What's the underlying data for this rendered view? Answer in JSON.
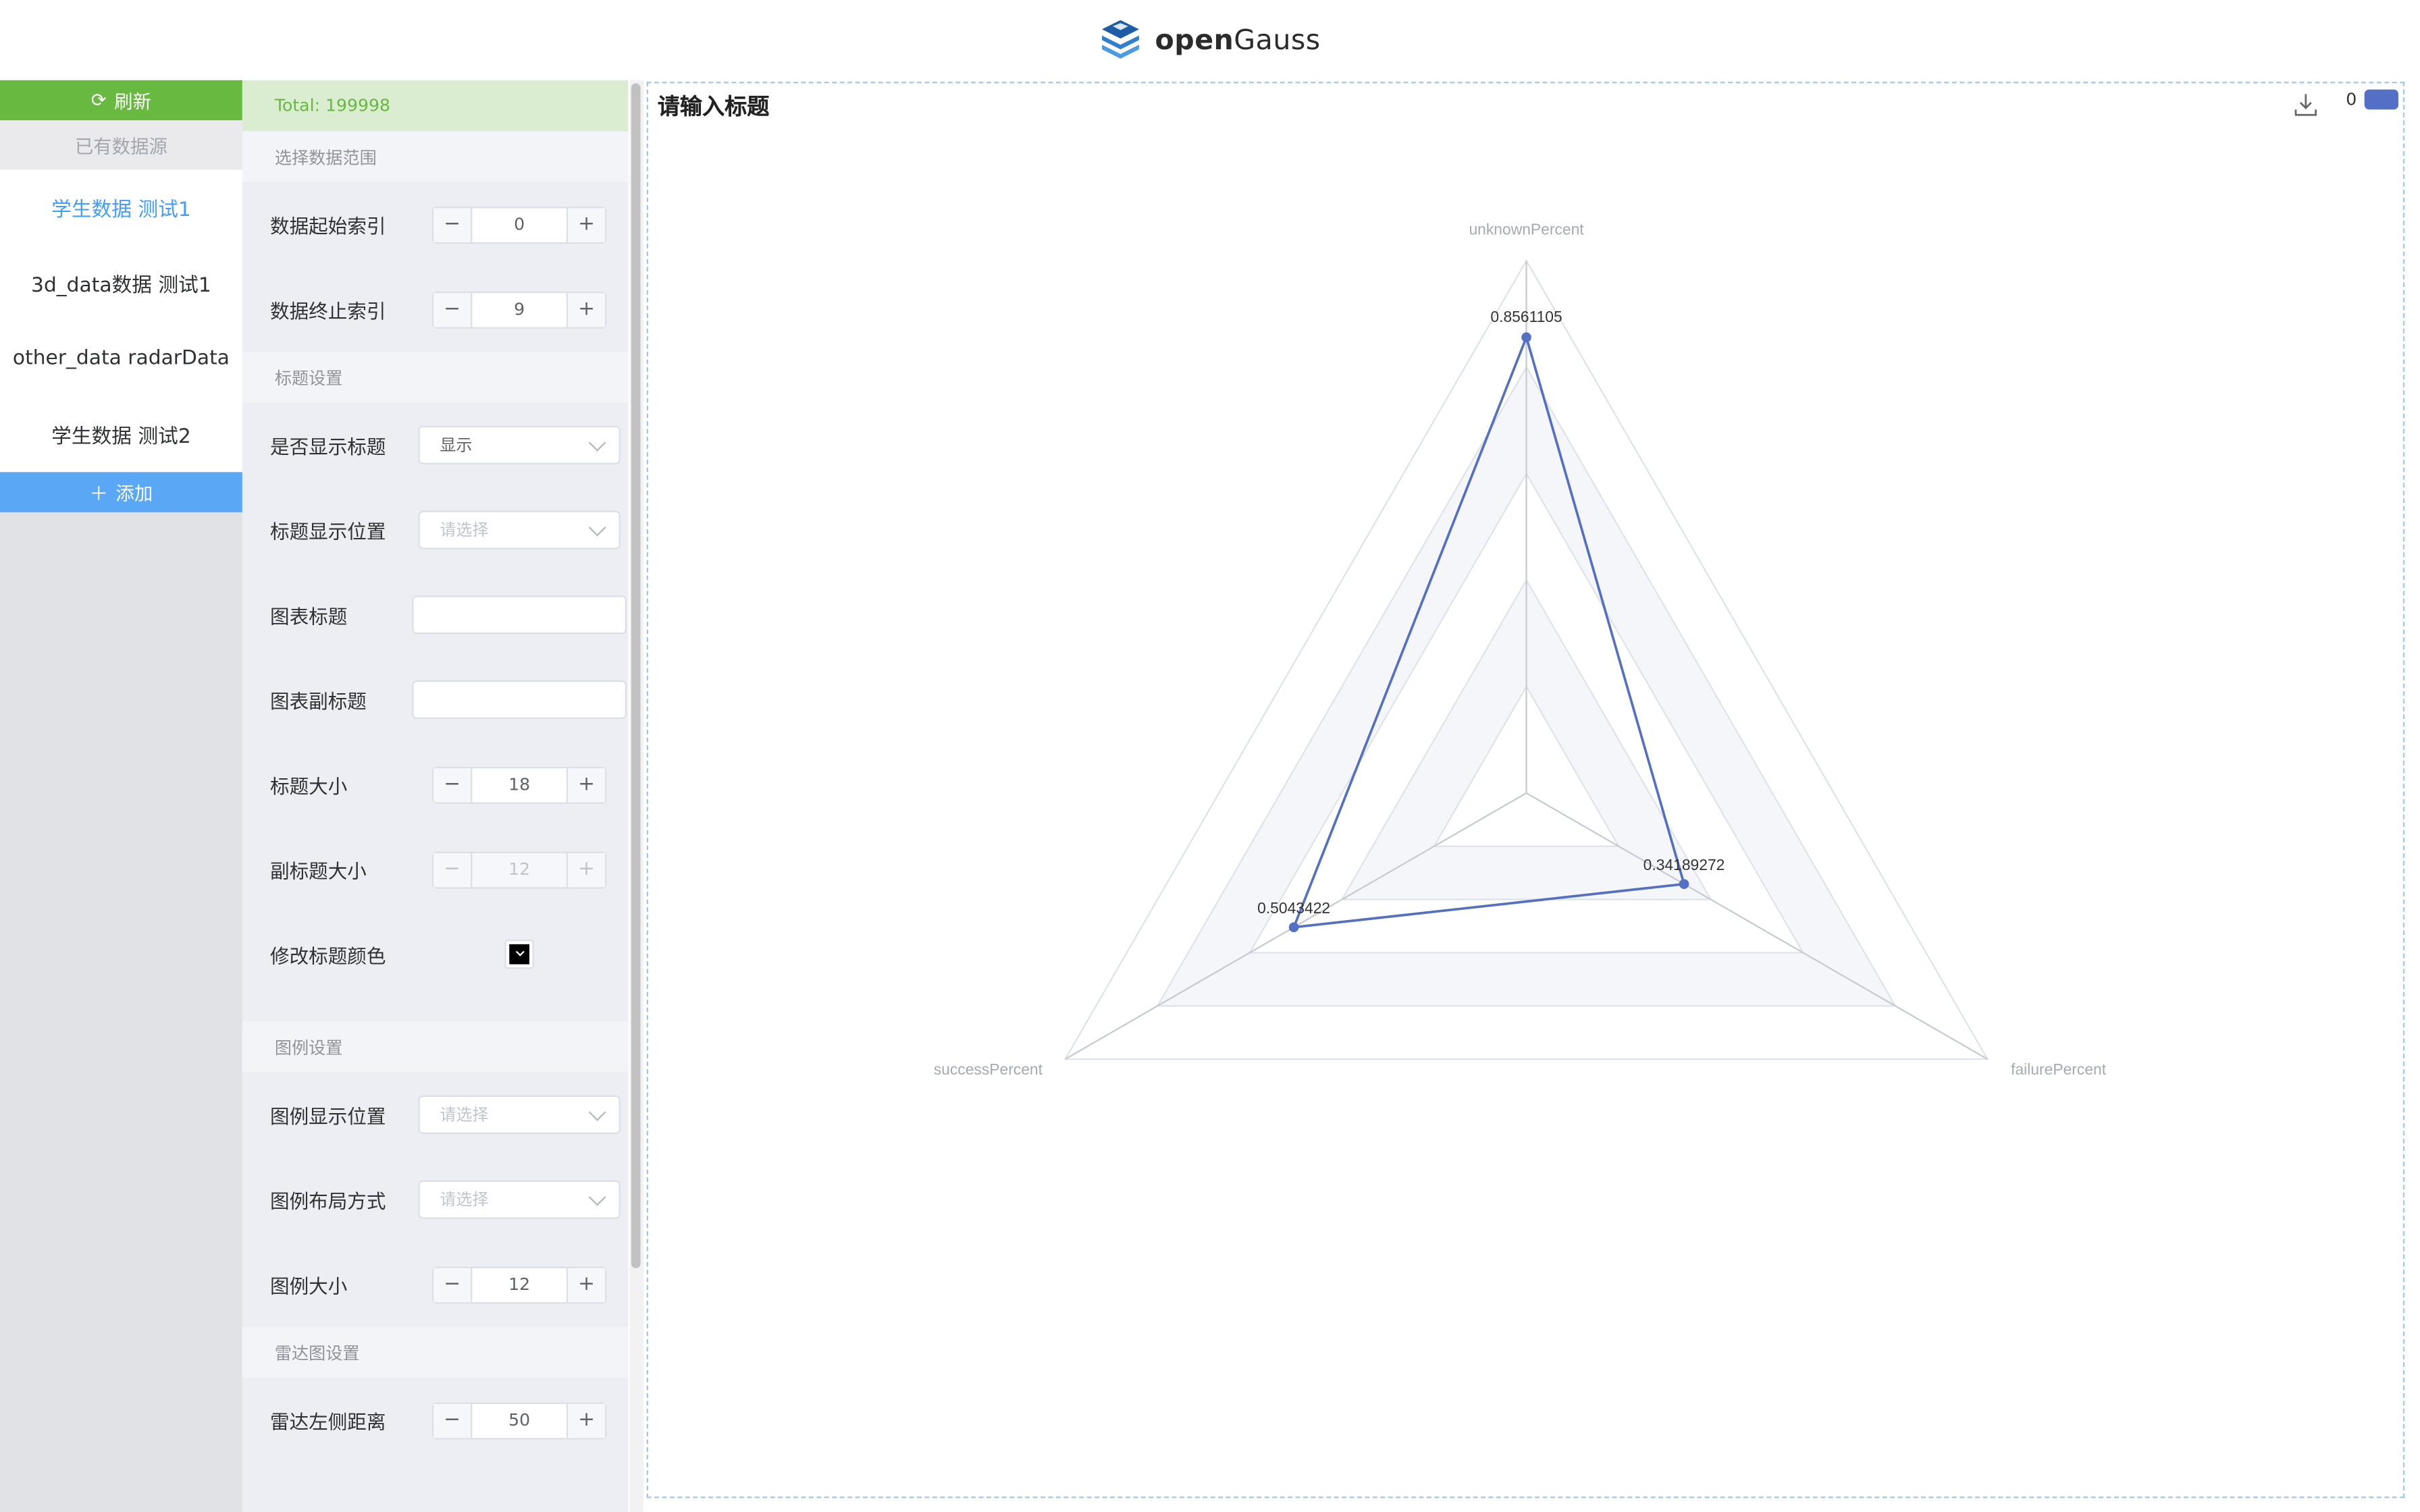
{
  "header": {
    "logo_bold": "open",
    "logo_light": "Gauss"
  },
  "sources": {
    "refresh_label": "刷新",
    "title": "已有数据源",
    "items": [
      "学生数据 测试1",
      "3d_data数据 测试1",
      "other_data radarData",
      "学生数据 测试2"
    ],
    "active_index": 0,
    "add_label": "添加"
  },
  "config": {
    "total": "Total: 199998",
    "range": {
      "title": "选择数据范围",
      "start_label": "数据起始索引",
      "start_value": "0",
      "end_label": "数据终止索引",
      "end_value": "9"
    },
    "title_settings": {
      "title": "标题设置",
      "show_label": "是否显示标题",
      "show_value": "显示",
      "position_label": "标题显示位置",
      "position_placeholder": "请选择",
      "chart_title_label": "图表标题",
      "subtitle_label": "图表副标题",
      "size_label": "标题大小",
      "size_value": "18",
      "sub_size_label": "副标题大小",
      "sub_size_value": "12",
      "color_label": "修改标题颜色",
      "color": "#000000"
    },
    "legend_settings": {
      "title": "图例设置",
      "position_label": "图例显示位置",
      "position_placeholder": "请选择",
      "layout_label": "图例布局方式",
      "layout_placeholder": "请选择",
      "size_label": "图例大小",
      "size_value": "12"
    },
    "radar_settings": {
      "title": "雷达图设置",
      "left_label": "雷达左侧距离",
      "left_value": "50"
    },
    "stepper_minus": "−",
    "stepper_plus": "+"
  },
  "chart": {
    "title": "请输入标题",
    "legend_name": "0",
    "download_icon": "download-icon"
  },
  "chart_data": {
    "type": "radar",
    "indicators": [
      "unknownPercent",
      "failurePercent",
      "successPercent"
    ],
    "max": 1,
    "series": [
      {
        "name": "0",
        "values": [
          0.8561105,
          0.34189272,
          0.5043422
        ],
        "labels": [
          "0.8561105",
          "0.34189272",
          "0.5043422"
        ]
      }
    ],
    "split_number": 5,
    "line_color": "#5470c6",
    "split_area_colors": [
      "#ffffff",
      "#f5f6fa"
    ]
  }
}
